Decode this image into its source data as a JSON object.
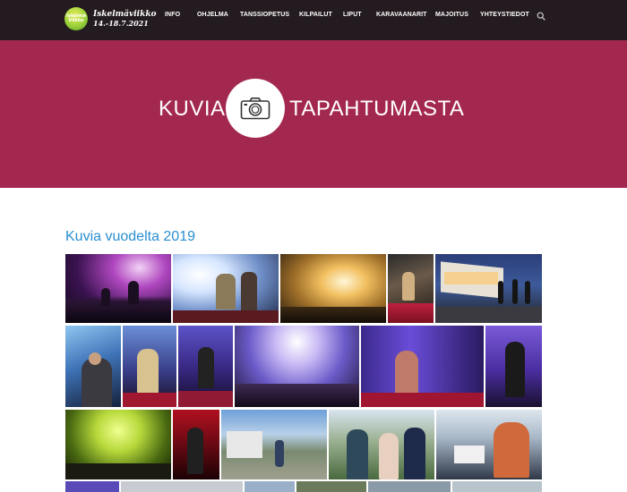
{
  "header": {
    "logo_badge_text": "Iskelmä Viikko",
    "logo_title": "Iskelmäviikko",
    "logo_dates": "14.-18.7.2021",
    "nav": [
      {
        "label": "INFO"
      },
      {
        "label": "OHJELMA"
      },
      {
        "label": "TANSSIOPETUS"
      },
      {
        "label": "KILPAILUT"
      },
      {
        "label": "LIPUT"
      },
      {
        "label": "KARAVAANARIT"
      },
      {
        "label": "MAJOITUS"
      },
      {
        "label": "YHTEYSTIEDOT"
      }
    ],
    "search_icon": "search-icon"
  },
  "hero": {
    "left_word": "KUVIA",
    "right_word": "TAPAHTUMASTA",
    "icon": "camera-icon"
  },
  "section": {
    "title": "Kuvia vuodelta 2019"
  },
  "colors": {
    "topbar": "#231b1f",
    "hero": "#a3284f",
    "title_blue": "#2a8fd0"
  }
}
